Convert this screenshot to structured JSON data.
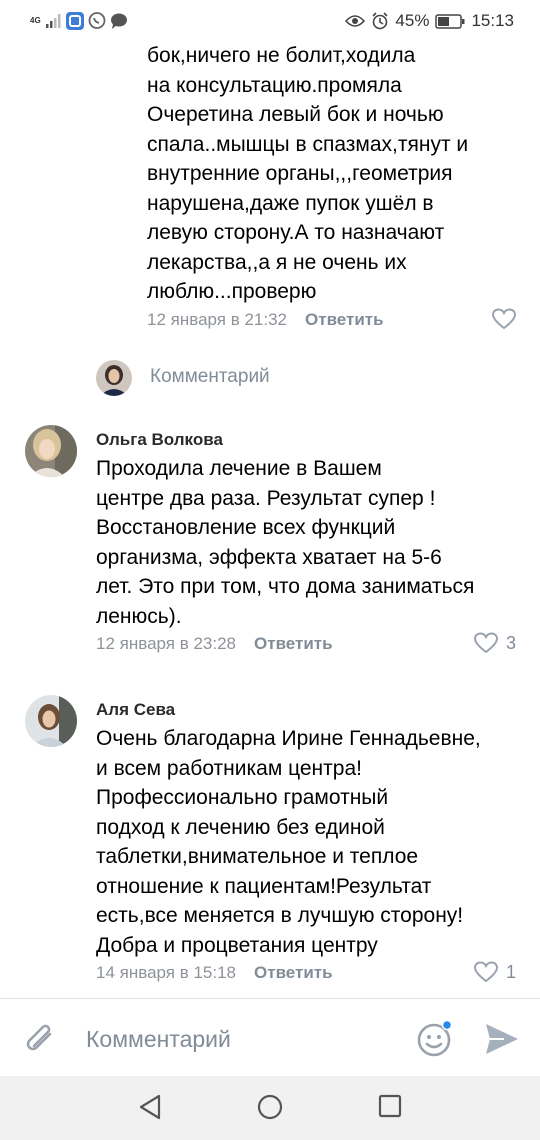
{
  "status_bar": {
    "network": "4G",
    "battery": "45%",
    "time": "15:13"
  },
  "comments": [
    {
      "text": "бок,ничего не болит,ходила\nна консультацию.промяла\nОчеретина левый бок и ночью\nспала..мышцы в спазмах,тянут и\nвнутренние органы,,,геометрия\nнарушена,даже пупок ушёл в\nлевую сторону.А то назначают\nлекарства,,а я не очень их\nлюблю...проверю",
      "date": "12 января в 21:32",
      "reply": "Ответить"
    },
    {
      "author": "Ольга Волкова",
      "text": "Проходила лечение в Вашем\nцентре два раза. Результат супер !\nВосстановление всех функций\nорганизма, эффекта хватает на 5-6\nлет. Это при том, что дома заниматься\nленюсь).",
      "date": "12 января в 23:28",
      "reply": "Ответить",
      "likes": "3"
    },
    {
      "author": "Аля Сева",
      "text": "Очень благодарна Ирине Геннадьевне,\nи всем работникам центра!\nПрофессионально грамотный\nподход к лечению без единой\nтаблетки,внимательное и теплое\nотношение к пациентам!Результат\nесть,все меняется в лучшую сторону!\nДобра и процветания центру",
      "date": "14 января в 15:18",
      "reply": "Ответить",
      "likes": "1"
    }
  ],
  "inline_reply": {
    "placeholder": "Комментарий"
  },
  "composer": {
    "placeholder": "Комментарий"
  },
  "colors": {
    "meta": "#8e9399",
    "accent": "#2688eb",
    "icon": "#99a2ad"
  }
}
